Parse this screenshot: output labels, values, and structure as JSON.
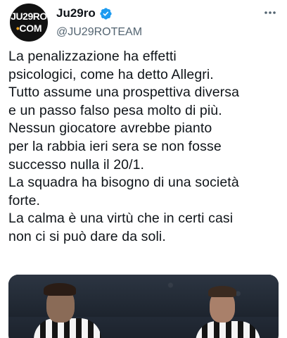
{
  "account": {
    "avatar_text_line1": "JU29RO",
    "avatar_text_line2_dot": "•",
    "avatar_text_line2": "COM",
    "display_name": "Ju29ro",
    "handle": "@JU29ROTEAM",
    "verified": true
  },
  "icons": {
    "verified": "verified-badge-icon",
    "more": "more-options-icon"
  },
  "tweet": {
    "lines": [
      "La penalizzazione ha effetti",
      "psicologici, come ha detto Allegri.",
      "Tutto assume una prospettiva diversa",
      "e un passo falso pesa molto di più.",
      "Nessun giocatore avrebbe pianto",
      "per la rabbia ieri sera se non fosse",
      "successo nulla il 20/1.",
      "La squadra ha bisogno di una società",
      "forte.",
      "La calma è una virtù che in certi casi",
      "non ci si può dare da soli."
    ]
  },
  "colors": {
    "verified_blue": "#1d9bf0",
    "secondary_text": "#536471",
    "avatar_accent": "#f5a623"
  }
}
